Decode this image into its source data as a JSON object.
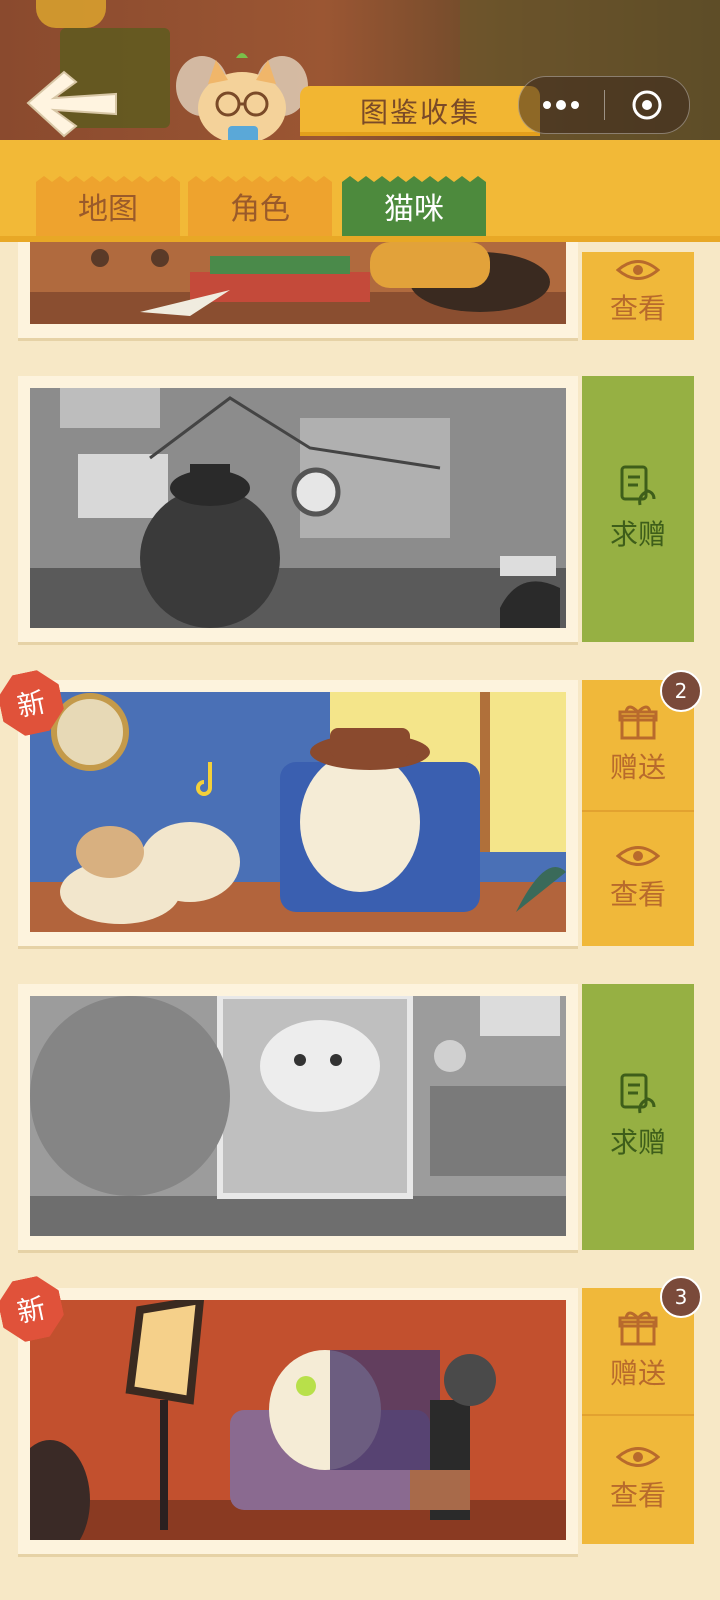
{
  "header": {
    "title": "图鉴收集",
    "back_icon": "back-arrow-icon",
    "more_icon": "more-dots-icon",
    "close_icon": "target-close-icon"
  },
  "tabs": [
    {
      "label": "地图",
      "active": false
    },
    {
      "label": "角色",
      "active": false
    },
    {
      "label": "猫咪",
      "active": true
    }
  ],
  "cards": [
    {
      "id": "card-1",
      "scene": "color-warm",
      "actions": [
        {
          "type": "view",
          "label": "查看",
          "icon": "eye-icon"
        }
      ]
    },
    {
      "id": "card-2",
      "scene": "gray",
      "actions": [
        {
          "type": "request",
          "label": "求赠",
          "icon": "request-gift-icon"
        }
      ]
    },
    {
      "id": "card-3",
      "scene": "color-blue",
      "new_tag": "新",
      "badge": "2",
      "actions": [
        {
          "type": "gift",
          "label": "赠送",
          "icon": "gift-icon"
        },
        {
          "type": "view",
          "label": "查看",
          "icon": "eye-icon"
        }
      ]
    },
    {
      "id": "card-4",
      "scene": "gray",
      "actions": [
        {
          "type": "request",
          "label": "求赠",
          "icon": "request-gift-icon"
        }
      ]
    },
    {
      "id": "card-5",
      "scene": "color-red",
      "new_tag": "新",
      "badge": "3",
      "actions": [
        {
          "type": "gift",
          "label": "赠送",
          "icon": "gift-icon"
        },
        {
          "type": "view",
          "label": "查看",
          "icon": "eye-icon"
        }
      ]
    }
  ],
  "colors": {
    "background": "#f7e8c6",
    "tab_inactive": "#eea32e",
    "tab_active": "#4d8a3d",
    "action_orange": "#f0b83a",
    "action_green": "#96b043",
    "badge": "#7a4a3a",
    "new_tag": "#e0523a"
  }
}
